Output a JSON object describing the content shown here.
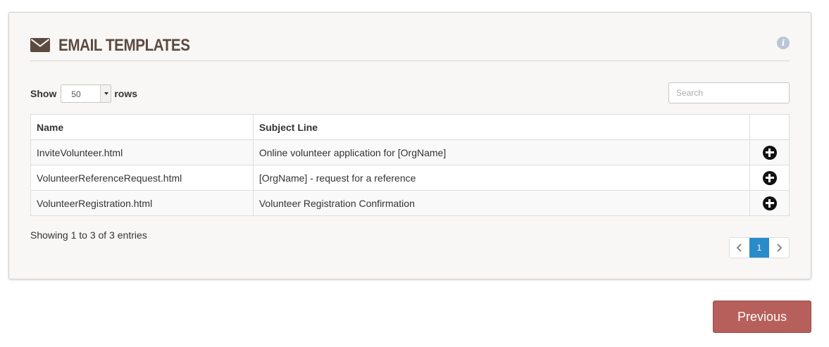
{
  "panel": {
    "title": "EMAIL TEMPLATES",
    "info_icon": "info-icon",
    "info_glyph": "i"
  },
  "length_control": {
    "show_label": "Show",
    "selected": "50",
    "rows_label": "rows"
  },
  "search": {
    "placeholder": "Search",
    "value": ""
  },
  "table": {
    "columns": [
      "Name",
      "Subject Line",
      ""
    ],
    "rows": [
      {
        "name": "InviteVolunteer.html",
        "subject": "Online volunteer application for [OrgName]",
        "action_icon": "plus-circle-icon"
      },
      {
        "name": "VolunteerReferenceRequest.html",
        "subject": "[OrgName] - request for a reference",
        "action_icon": "plus-circle-icon"
      },
      {
        "name": "VolunteerRegistration.html",
        "subject": "Volunteer Registration Confirmation",
        "action_icon": "plus-circle-icon"
      }
    ]
  },
  "info_text": "Showing 1 to 3 of 3 entries",
  "pagination": {
    "prev_icon": "chevron-left-icon",
    "pages": [
      "1"
    ],
    "current": "1",
    "next_icon": "chevron-right-icon"
  },
  "footer": {
    "previous_label": "Previous"
  },
  "colors": {
    "accent": "#2a8bc9",
    "previous_button": "#b75f5a",
    "title": "#5c4a40",
    "panel_bg": "#f8f7f5"
  }
}
